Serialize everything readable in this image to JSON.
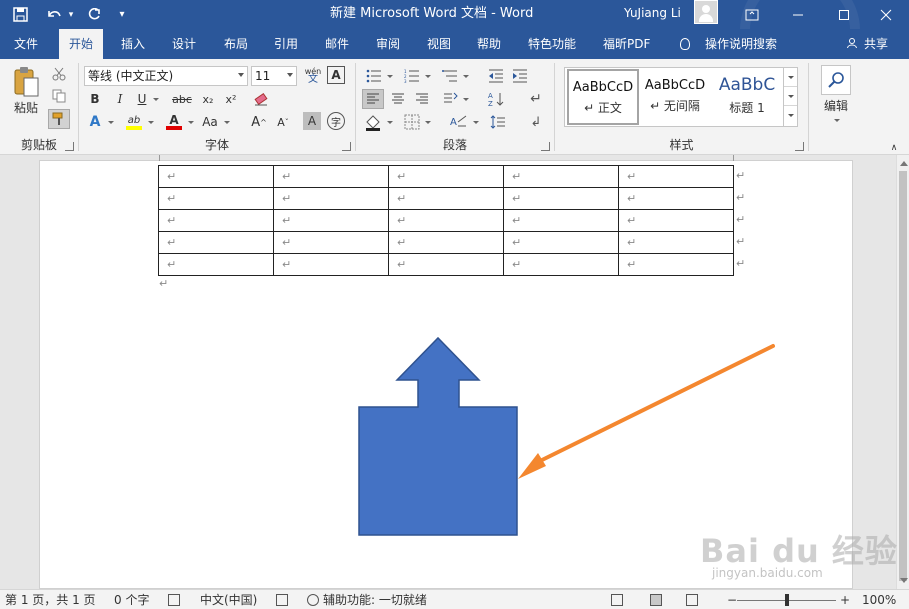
{
  "window": {
    "title": "新建 Microsoft Word 文档  -  Word",
    "user_name": "YuJiang Li"
  },
  "tabs": [
    "文件",
    "开始",
    "插入",
    "设计",
    "布局",
    "引用",
    "邮件",
    "审阅",
    "视图",
    "帮助",
    "特色功能",
    "福昕PDF"
  ],
  "active_tab": "开始",
  "tell_me": "操作说明搜索",
  "share_label": "共享",
  "ribbon": {
    "clipboard": {
      "label": "剪贴板",
      "paste_label": "粘贴"
    },
    "font": {
      "label": "字体",
      "font_name": "等线 (中文正文)",
      "font_size": "11",
      "phonetic_label": "wén",
      "bold": "B",
      "italic": "I",
      "underline": "U",
      "strike": "abc",
      "subscript": "x₂",
      "superscript": "x²",
      "grow": "A",
      "shrink": "A",
      "case": "Aa",
      "enclose": "字",
      "shade": "A",
      "border_char": "A",
      "highlight": "ab",
      "font_color": "A"
    },
    "paragraph": {
      "label": "段落"
    },
    "styles": {
      "label": "样式",
      "items": [
        {
          "sample": "AaBbCcD",
          "name": "↵ 正文"
        },
        {
          "sample": "AaBbCcD",
          "name": "↵ 无间隔"
        },
        {
          "sample": "AaBbC",
          "name": "标题 1"
        }
      ]
    },
    "editing": {
      "label": "编辑"
    }
  },
  "document": {
    "table_rows": 5,
    "table_cols": 5,
    "cell_mark": "↵",
    "colors": {
      "shape_fill": "#4472c4",
      "shape_stroke": "#2f528f",
      "arrow": "#f4872f"
    }
  },
  "status": {
    "page": "第 1 页，共 1 页",
    "words": "0 个字",
    "language": "中文(中国)",
    "accessibility": "辅助功能: 一切就绪",
    "zoom": "100%"
  },
  "watermark": {
    "main": "Bai du 经验",
    "sub": "jingyan.baidu.com"
  }
}
